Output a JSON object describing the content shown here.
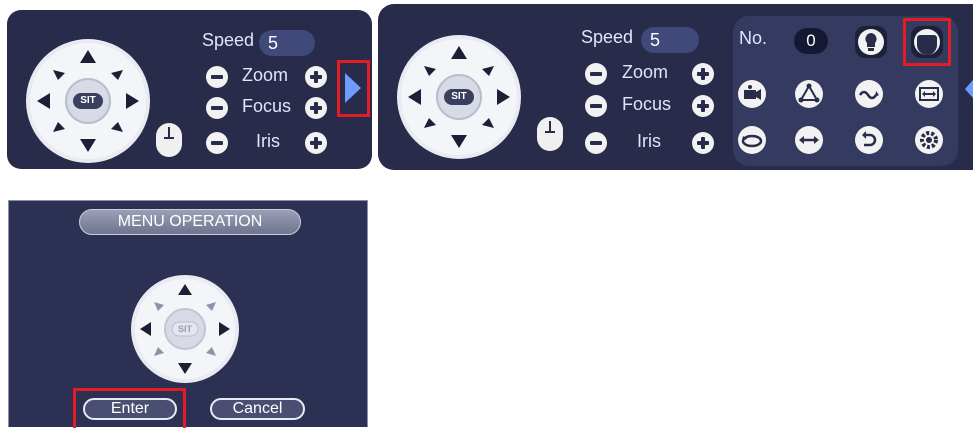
{
  "ptz_small": {
    "center_label": "SIT",
    "speed_label": "Speed",
    "speed_value": "5",
    "zoom_label": "Zoom",
    "focus_label": "Focus",
    "iris_label": "Iris"
  },
  "ptz_expanded": {
    "center_label": "SIT",
    "speed_label": "Speed",
    "speed_value": "5",
    "zoom_label": "Zoom",
    "focus_label": "Focus",
    "iris_label": "Iris",
    "no_label": "No.",
    "no_value": "0",
    "function_icons": [
      "light-bulb-icon",
      "wiper-icon",
      "preset-camera-icon",
      "tour-icon",
      "pattern-icon",
      "scan-icon",
      "rotate-icon",
      "pan-icon",
      "flip-icon",
      "settings-gear-icon"
    ]
  },
  "menu_operation": {
    "title": "MENU OPERATION",
    "center_label": "SIT",
    "enter_label": "Enter",
    "cancel_label": "Cancel"
  },
  "colors": {
    "panel": "#282c4a",
    "highlight": "#e21d23",
    "arrow_accent": "#6f9bff"
  }
}
